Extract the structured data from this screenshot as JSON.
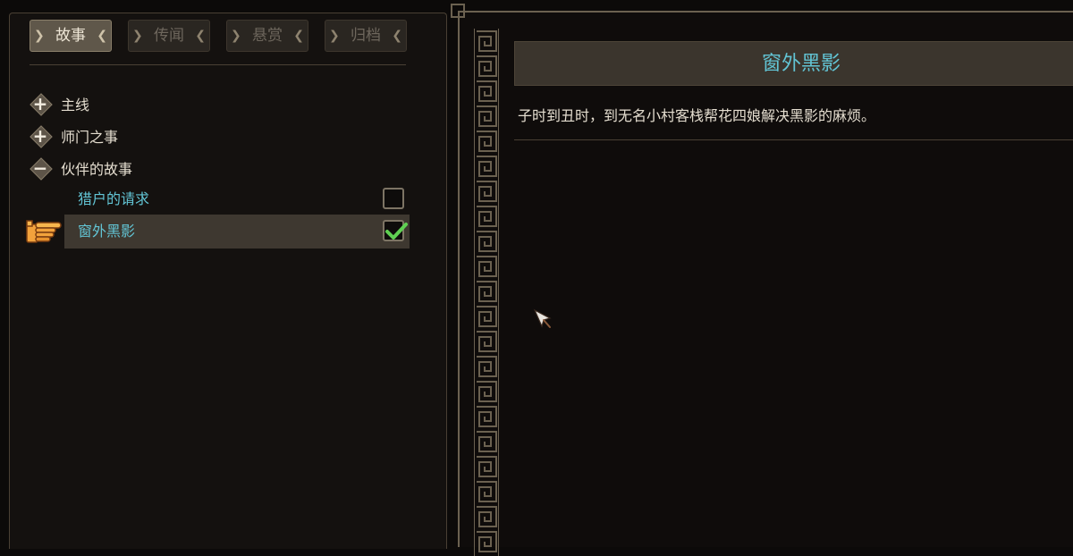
{
  "tabs": [
    {
      "label": "故事",
      "active": true
    },
    {
      "label": "传闻",
      "active": false
    },
    {
      "label": "悬赏",
      "active": false
    },
    {
      "label": "归档",
      "active": false
    }
  ],
  "categories": [
    {
      "label": "主线",
      "expanded": false,
      "icon": "plus-icon"
    },
    {
      "label": "师门之事",
      "expanded": false,
      "icon": "plus-icon"
    },
    {
      "label": "伙伴的故事",
      "expanded": true,
      "icon": "minus-icon"
    }
  ],
  "quests": [
    {
      "label": "猎户的请求",
      "completed": false,
      "selected": false
    },
    {
      "label": "窗外黑影",
      "completed": true,
      "selected": true
    }
  ],
  "detail": {
    "title": "窗外黑影",
    "description": "子时到丑时，到无名小村客栈帮花四娘解决黑影的麻烦。"
  },
  "colors": {
    "accent_cyan": "#62c4d4",
    "check_green": "#5fcf52",
    "hand_orange": "#f2a23c"
  }
}
